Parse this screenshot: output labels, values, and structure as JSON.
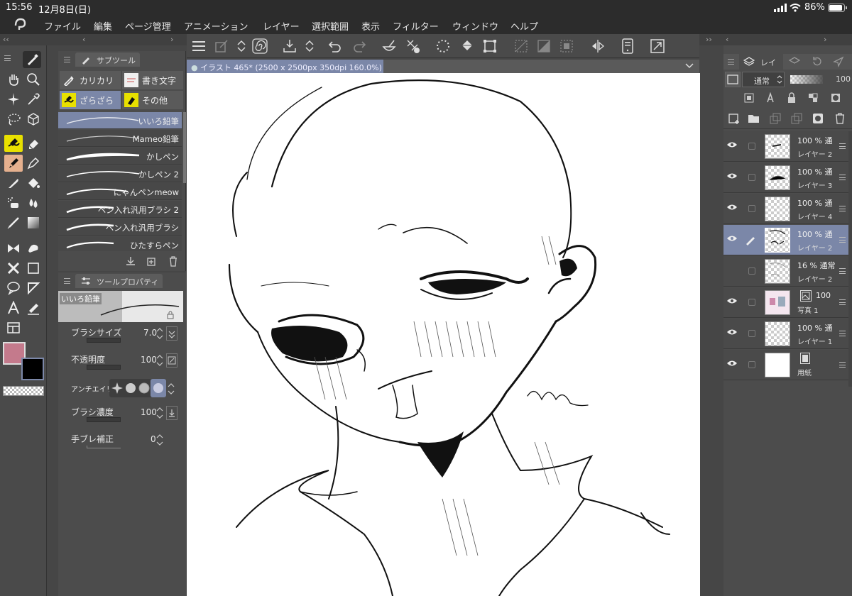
{
  "status": {
    "time": "15:56",
    "date": "12月8日(日)",
    "battery": "86%"
  },
  "menu": [
    "ファイル",
    "編集",
    "ページ管理",
    "アニメーション",
    "レイヤー",
    "選択範囲",
    "表示",
    "フィルター",
    "ウィンドウ",
    "ヘルプ"
  ],
  "document": {
    "tab_title": "イラスト 465* (2500 x 2500px 350dpi 160.0%)"
  },
  "subtool": {
    "title": "サブツール",
    "groups": [
      "カリカリ",
      "書き文字",
      "ざらざら",
      "その他"
    ],
    "brushes": [
      "いいろ鉛筆",
      "Mameo鉛筆",
      "かしペン",
      "かしペン 2",
      "にゃんペンmeow",
      "ペン入れ汎用ブラシ 2",
      "ペン入れ汎用ブラシ",
      "ひたすらペン"
    ]
  },
  "toolprop": {
    "title": "ツールプロパティ",
    "preview_label": "いいろ鉛筆",
    "brush_size_label": "ブラシサイズ",
    "brush_size_value": "7.0",
    "opacity_label": "不透明度",
    "opacity_value": "100",
    "antialias_label": "アンチエイリ",
    "density_label": "ブラシ濃度",
    "density_value": "100",
    "stabilization_label": "手ブレ補正",
    "stabilization_value": "0"
  },
  "layers": {
    "tab_label": "レイ",
    "blend_mode": "通常",
    "opacity": "100",
    "rows": [
      {
        "opacity": "100 %",
        "mode": "通",
        "name": "レイヤー 2"
      },
      {
        "opacity": "100 %",
        "mode": "通",
        "name": "レイヤー 3"
      },
      {
        "opacity": "100 %",
        "mode": "通",
        "name": "レイヤー 4"
      },
      {
        "opacity": "100 %",
        "mode": "通",
        "name": "レイヤー 2"
      },
      {
        "opacity": "16 %",
        "mode": "通常",
        "name": "レイヤー 2"
      },
      {
        "opacity": "100",
        "mode": "",
        "name": "写真 1"
      },
      {
        "opacity": "100 %",
        "mode": "通",
        "name": "レイヤー 1"
      },
      {
        "opacity": "",
        "mode": "",
        "name": "用紙"
      }
    ]
  },
  "colors": {
    "main": "#c47a8c",
    "sub": "#000000",
    "accent": "#7b87a8"
  }
}
